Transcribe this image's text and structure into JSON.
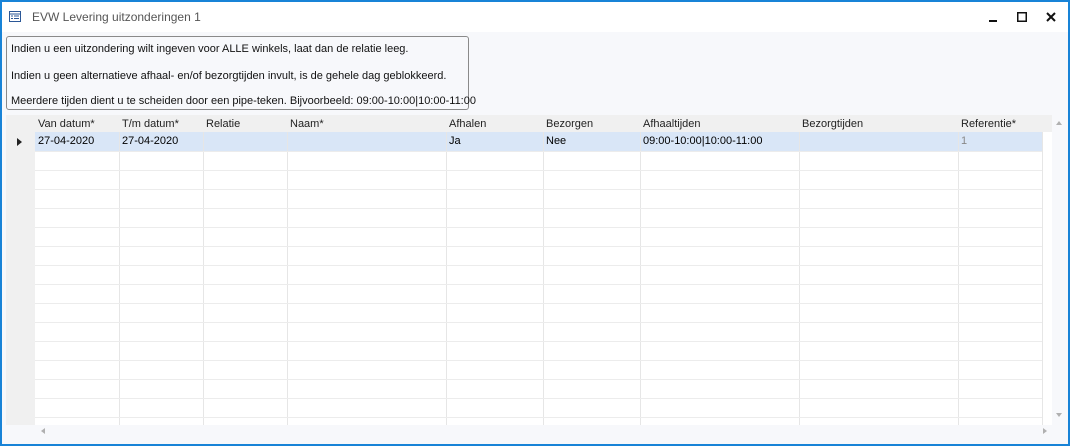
{
  "window": {
    "title": "EVW Levering uitzonderingen 1",
    "minimize_glyph": "–",
    "maximize_glyph": "☐",
    "close_glyph": "✕"
  },
  "info": {
    "line1": "Indien u een uitzondering wilt ingeven voor ALLE winkels, laat dan de relatie leeg.",
    "line2": "Indien u geen alternatieve afhaal- en/of bezorgtijden invult, is de gehele dag geblokkeerd.",
    "line3": "Meerdere tijden dient u te scheiden door een pipe-teken. Bijvoorbeeld: 09:00-10:00|10:00-11:00"
  },
  "grid": {
    "columns": [
      "Van datum*",
      "T/m datum*",
      "Relatie",
      "Naam*",
      "Afhalen",
      "Bezorgen",
      "Afhaaltijden",
      "Bezorgtijden",
      "Referentie*"
    ],
    "rows": [
      [
        "27-04-2020",
        "27-04-2020",
        "",
        "",
        "Ja",
        "Nee",
        "09:00-10:00|10:00-11:00",
        "",
        "1"
      ]
    ]
  },
  "colors": {
    "window_border": "#1883d7",
    "selected_row": "#d9e6f7"
  },
  "icons": {
    "app": "grid-form-icon",
    "row_indicator": "current-row-arrow-icon"
  }
}
